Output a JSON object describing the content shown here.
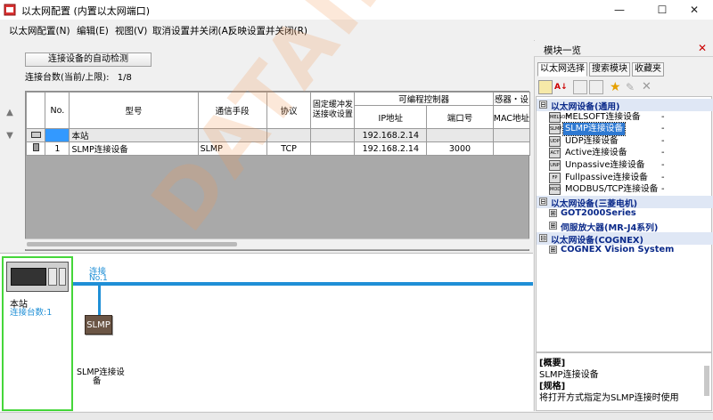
{
  "window": {
    "title": "以太网配置 (内置以太网端口)",
    "controls": [
      "minimize-icon",
      "maximize-icon",
      "close-icon"
    ]
  },
  "menu": [
    "以太网配置(N)",
    "编辑(E)",
    "视图(V)",
    "取消设置并关闭(A)",
    "反映设置并关闭(R)"
  ],
  "left": {
    "autodetect_label": "连接设备的自动检测",
    "conn_count_label": "连接台数(当前/上限):",
    "conn_count_value": "1/8"
  },
  "table": {
    "headers": {
      "no": "No.",
      "model": "型号",
      "comm": "通信手段",
      "protocol": "协议",
      "buffer": "固定缓冲发送接收设置",
      "plc_group": "可编程控制器",
      "ip": "IP地址",
      "port": "端口号",
      "sensor_group": "感器・设",
      "mac": "MAC地址"
    },
    "rows": [
      {
        "no": "",
        "model": "本站",
        "comm": "",
        "protocol": "",
        "buffer": "",
        "ip": "192.168.2.14",
        "port": "",
        "mac": ""
      },
      {
        "no": "1",
        "model": "SLMP连接设备",
        "comm": "SLMP",
        "protocol": "TCP",
        "buffer": "",
        "ip": "192.168.2.14",
        "port": "3000",
        "mac": ""
      }
    ]
  },
  "diagram": {
    "station_label": "本站",
    "station_count": "连接台数:1",
    "line_label": "连接",
    "line_sub": "No.1",
    "node_label": "SLMP",
    "node_name_1": "SLMP连接设",
    "node_name_2": "备"
  },
  "panel": {
    "title": "模块一览",
    "tabs": [
      "以太网选择",
      "搜索模块",
      "收藏夹"
    ],
    "tree": [
      {
        "type": "cat",
        "label": "以太网设备(通用)",
        "exp": "⊟"
      },
      {
        "type": "item",
        "icon": "MELSOFT",
        "label": "MELSOFT连接设备",
        "val": "-"
      },
      {
        "type": "item",
        "icon": "SLMP",
        "label": "SLMP连接设备",
        "val": "-",
        "selected": true
      },
      {
        "type": "item",
        "icon": "UDP",
        "label": "UDP连接设备",
        "val": "-"
      },
      {
        "type": "item",
        "icon": "ACT",
        "label": "Active连接设备",
        "val": "-"
      },
      {
        "type": "item",
        "icon": "UNP",
        "label": "Unpassive连接设备",
        "val": "-"
      },
      {
        "type": "item",
        "icon": "FP",
        "label": "Fullpassive连接设备",
        "val": "-"
      },
      {
        "type": "item",
        "icon": "MOD",
        "label": "MODBUS/TCP连接设备",
        "val": "-"
      },
      {
        "type": "cat",
        "label": "以太网设备(三菱电机)",
        "exp": "⊟"
      },
      {
        "type": "sub",
        "label": "GOT2000Series",
        "exp": "⊞"
      },
      {
        "type": "sub",
        "label": "伺服放大器(MR-J4系列)",
        "exp": "⊞"
      },
      {
        "type": "cat",
        "label": "以太网设备(COGNEX)",
        "exp": "⊟"
      },
      {
        "type": "sub",
        "label": "COGNEX Vision System",
        "exp": "⊞"
      }
    ],
    "desc": {
      "overview_title": "[概要]",
      "overview_text": "SLMP连接设备",
      "spec_title": "[规格]",
      "spec_text": "将打开方式指定为SLMP连接时使用"
    }
  },
  "watermark": "DATAIE",
  "colors": {
    "accent": "#1f8fd6",
    "selection": "#3399ff",
    "station_border": "#45d63a",
    "node": "#6b5545",
    "category_text": "#0b2a8a"
  }
}
